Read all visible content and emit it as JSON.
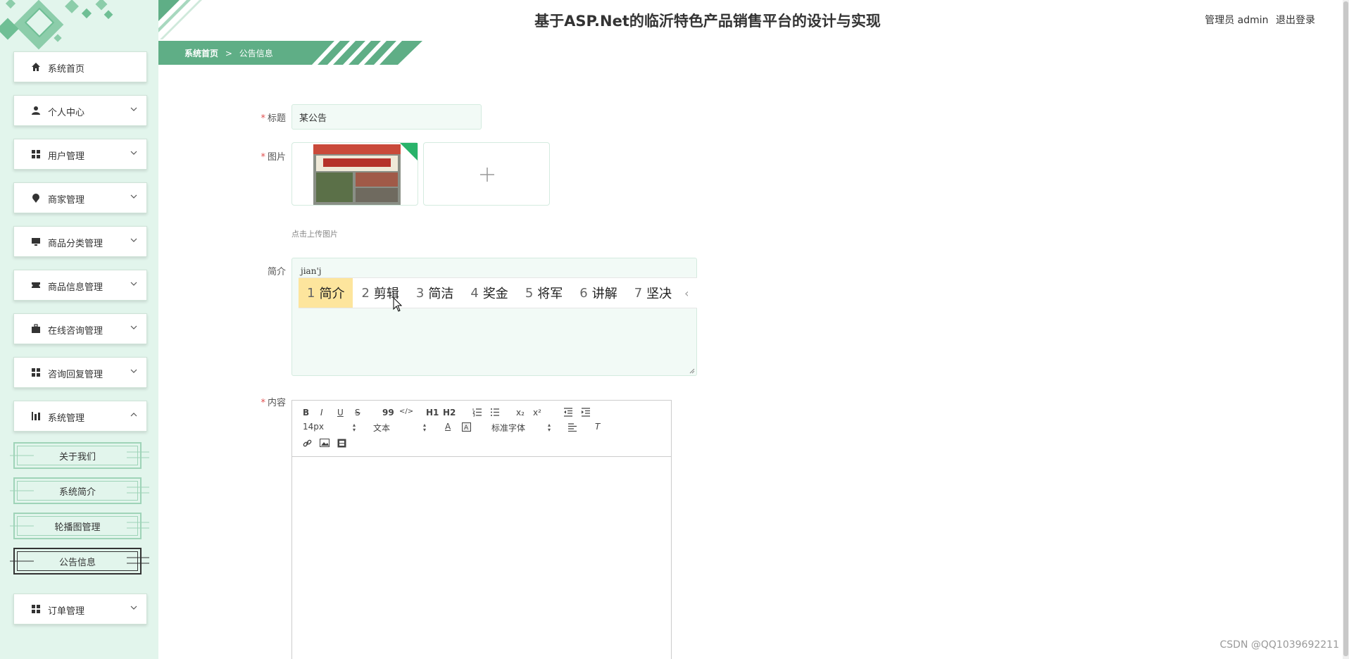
{
  "header": {
    "title": "基于ASP.Net的临沂特色产品销售平台的设计与实现",
    "user_role": "管理员 admin",
    "logout": "退出登录"
  },
  "breadcrumb": {
    "home": "系统首页",
    "separator": ">",
    "current": "公告信息"
  },
  "sidebar": {
    "items": [
      {
        "label": "系统首页",
        "icon": "home-icon"
      },
      {
        "label": "个人中心",
        "icon": "user-icon"
      },
      {
        "label": "用户管理",
        "icon": "grid-icon"
      },
      {
        "label": "商家管理",
        "icon": "pin-icon"
      },
      {
        "label": "商品分类管理",
        "icon": "monitor-icon"
      },
      {
        "label": "商品信息管理",
        "icon": "ticket-icon"
      },
      {
        "label": "在线咨询管理",
        "icon": "briefcase-icon"
      },
      {
        "label": "咨询回复管理",
        "icon": "grid-icon"
      },
      {
        "label": "系统管理",
        "icon": "chart-icon"
      },
      {
        "label": "订单管理",
        "icon": "grid-icon"
      }
    ],
    "sub_items": [
      "关于我们",
      "系统简介",
      "轮播图管理",
      "公告信息"
    ]
  },
  "form": {
    "title_label": "标题",
    "title_value": "某公告",
    "image_label": "图片",
    "upload_hint": "点击上传图片",
    "intro_label": "简介",
    "intro_typed": "jian'j",
    "content_label": "内容",
    "required_mark": "*"
  },
  "ime": {
    "candidates": [
      {
        "num": "1",
        "text": "简介"
      },
      {
        "num": "2",
        "text": "剪辑"
      },
      {
        "num": "3",
        "text": "简洁"
      },
      {
        "num": "4",
        "text": "奖金"
      },
      {
        "num": "5",
        "text": "将军"
      },
      {
        "num": "6",
        "text": "讲解"
      },
      {
        "num": "7",
        "text": "坚决"
      }
    ],
    "arrow": "‹"
  },
  "editor": {
    "font_size": "14px",
    "block_type": "文本",
    "font_family": "标准字体",
    "buttons": [
      "B",
      "I",
      "U",
      "S",
      "99",
      "</>",
      "H1",
      "H2",
      "x₂",
      "x²",
      "A",
      "T"
    ]
  },
  "watermark": "CSDN @QQ1039692211",
  "colors": {
    "brand_green": "#5fae86",
    "sidebar_bg": "#e2f5ec",
    "ime_highlight": "#fde59d"
  }
}
